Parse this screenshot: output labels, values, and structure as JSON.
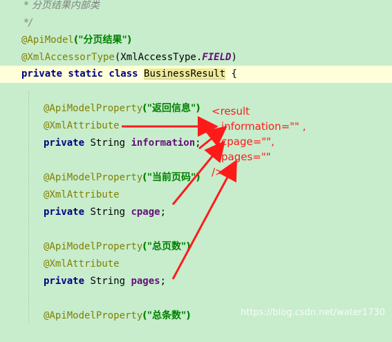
{
  "editor": {
    "comment_line1": " * 分页结果内部类",
    "comment_line2": " */",
    "api_model_ann": "@ApiModel",
    "api_model_val": "(\"分页结果\")",
    "xml_accessor_ann": "@XmlAccessorType",
    "xml_accessor_paren": "(XmlAccessType.",
    "xml_accessor_field": "FIELD",
    "xml_accessor_close": ")",
    "class_decl_kw": "private static class ",
    "class_name": "BusinessResult",
    "class_brace": " {",
    "fields": [
      {
        "prop_ann": "@ApiModelProperty",
        "prop_val": "(\"返回信息\")",
        "attr_ann": "@XmlAttribute",
        "decl_kw": "private ",
        "type": "String ",
        "name": "information",
        "end": ";"
      },
      {
        "prop_ann": "@ApiModelProperty",
        "prop_val": "(\"当前页码\")",
        "attr_ann": "@XmlAttribute",
        "decl_kw": "private ",
        "type": "String ",
        "name": "cpage",
        "end": ";"
      },
      {
        "prop_ann": "@ApiModelProperty",
        "prop_val": "(\"总页数\")",
        "attr_ann": "@XmlAttribute",
        "decl_kw": "private ",
        "type": "String ",
        "name": "pages",
        "end": ";"
      },
      {
        "prop_ann": "@ApiModelProperty",
        "prop_val": "(\"总条数\")"
      }
    ]
  },
  "annotation": {
    "lines": [
      "<result",
      "information=\"\" ,",
      "cpage=\"\",",
      "pages=\"\"",
      "/>"
    ],
    "color": "#ff1a1a"
  },
  "watermark": "https://blog.csdn.net/water1730",
  "colors": {
    "background": "#c7edcc",
    "current_line": "#ffffd9",
    "keyword": "#000080",
    "annotation": "#808000",
    "string": "#008000",
    "field": "#660e7a"
  }
}
